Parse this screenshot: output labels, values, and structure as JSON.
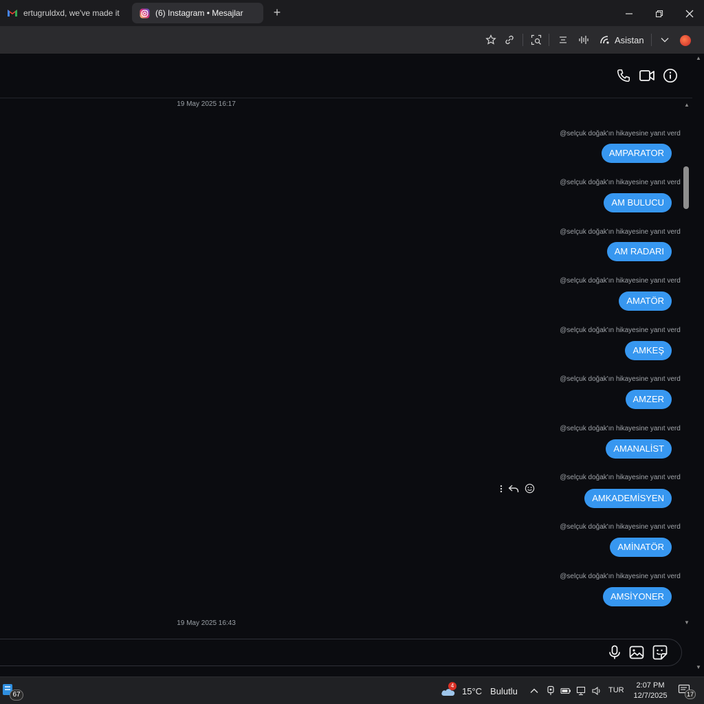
{
  "browser": {
    "tabs": [
      {
        "title": "ertugruldxd, we've made it ea",
        "icon": "gmail-icon"
      },
      {
        "title": "(6) Instagram • Mesajlar",
        "icon": "instagram-icon"
      }
    ],
    "assistant_label": "Asistan"
  },
  "chat": {
    "date_top": "19 May 2025 16:17",
    "date_bottom": "19 May 2025 16:43",
    "reply_context": "@selçuk doğak'ın hikayesine yanıt verdi",
    "messages": [
      {
        "reply": "@selçuk doğak'ın hikayesine yanıt verdi",
        "text": "AMPARATOR"
      },
      {
        "reply": "@selçuk doğak'ın hikayesine yanıt verdi",
        "text": "AM BULUCU"
      },
      {
        "reply": "@selçuk doğak'ın hikayesine yanıt verdi",
        "text": "AM RADARI"
      },
      {
        "reply": "@selçuk doğak'ın hikayesine yanıt verdi",
        "text": "AMATÖR"
      },
      {
        "reply": "@selçuk doğak'ın hikayesine yanıt verdi",
        "text": "AMKEŞ"
      },
      {
        "reply": "@selçuk doğak'ın hikayesine yanıt verdi",
        "text": "AMZER"
      },
      {
        "reply": "@selçuk doğak'ın hikayesine yanıt verdi",
        "text": "AMANALİST"
      },
      {
        "reply": "@selçuk doğak'ın hikayesine yanıt verdi",
        "text": "AMKADEMİSYEN"
      },
      {
        "reply": "@selçuk doğak'ın hikayesine yanıt verdi",
        "text": "AMİNATÖR"
      },
      {
        "reply": "@selçuk doğak'ın hikayesine yanıt verdi",
        "text": "AMSİYONER"
      }
    ],
    "accent_color": "#3797f0"
  },
  "taskbar": {
    "app_badge": "67",
    "weather_badge": "4",
    "temperature": "15°C",
    "weather_text": "Bulutlu",
    "language": "TUR",
    "time": "2:07 PM",
    "date": "12/7/2025",
    "notifications": "17"
  }
}
